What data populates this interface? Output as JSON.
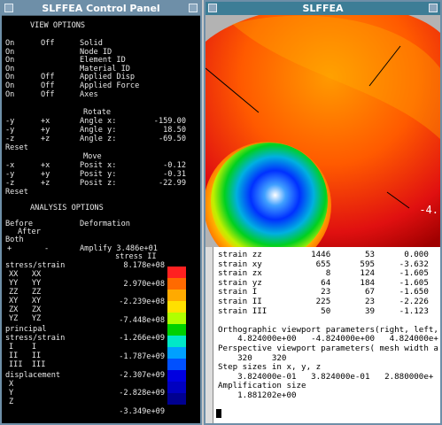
{
  "control_panel": {
    "title": "SLFFEA Control Panel",
    "view_header": "VIEW OPTIONS",
    "view_rows": [
      {
        "a": "On",
        "b": "Off",
        "label": "Solid"
      },
      {
        "a": "On",
        "b": "",
        "label": "Node ID"
      },
      {
        "a": "On",
        "b": "",
        "label": "Element ID"
      },
      {
        "a": "On",
        "b": "",
        "label": "Material ID"
      },
      {
        "a": "On",
        "b": "Off",
        "label": "Applied Disp"
      },
      {
        "a": "On",
        "b": "Off",
        "label": "Applied Force"
      },
      {
        "a": "On",
        "b": "Off",
        "label": "Axes"
      }
    ],
    "rotate_header": "Rotate",
    "rotate_rows": [
      {
        "a": "-y",
        "b": "+x",
        "label": "Angle x:",
        "value": "-159.00"
      },
      {
        "a": "-y",
        "b": "+y",
        "label": "Angle y:",
        "value": "18.50"
      },
      {
        "a": "-z",
        "b": "+z",
        "label": "Angle z:",
        "value": "-69.50"
      }
    ],
    "rotate_reset": "Reset",
    "move_header": "Move",
    "move_rows": [
      {
        "a": "-x",
        "b": "+x",
        "label": "Posit x:",
        "value": "-0.12"
      },
      {
        "a": "-y",
        "b": "+y",
        "label": "Posit y:",
        "value": "-0.31"
      },
      {
        "a": "-z",
        "b": "+z",
        "label": "Posit z:",
        "value": "-22.99"
      }
    ],
    "move_reset": "Reset",
    "analysis_header": "ANALYSIS OPTIONS",
    "before": "Before",
    "deformation": "Deformation",
    "after": "After",
    "both": "Both",
    "plus": "+",
    "minus": "-",
    "amplify": "Amplify 3.486e+01",
    "stress_label": "stress II",
    "stress_strain": "stress/strain",
    "legend_values": [
      "8.178e+08",
      "2.970e+08",
      "-2.239e+08",
      "-7.448e+08",
      "-1.266e+09",
      "-1.787e+09",
      "-2.307e+09",
      "-2.828e+09",
      "-3.349e+09"
    ],
    "left_list": [
      "XX   XX",
      "YY   YY",
      "ZZ   ZZ",
      "XY   XY",
      "ZX   ZX",
      "YZ   YZ"
    ],
    "principal": "principal",
    "stress_strain2": "stress/strain",
    "principal_rows": [
      "I    I",
      "II   II",
      "III  III"
    ],
    "displacement": "displacement",
    "disp_rows": [
      "X",
      "Y",
      "Z"
    ],
    "legend_colors": [
      "#ff2020",
      "#ff6a00",
      "#ffaa00",
      "#ffe000",
      "#b0ff00",
      "#00d000",
      "#00e8c8",
      "#00a0ff",
      "#0050ff",
      "#0000e0",
      "#0000c0",
      "#000090"
    ]
  },
  "viewer": {
    "title": "SLFFEA",
    "axis_label": "-4.",
    "console_lines": [
      "strain zz          1446       53      0.000",
      "strain xy           655      595     -3.632",
      "strain zx             8      124     -1.605",
      "strain yz            64      184     -1.605",
      "strain I             23       67     -1.650",
      "strain II           225       23     -2.226",
      "strain III           50       39     -1.123",
      "",
      "Orthographic viewport parameters(right, left,",
      "    4.824000e+00   -4.824000e+00   4.824000e+",
      "Perspective viewport parameters( mesh width a",
      "    320    320",
      "Step sizes in x, y, z",
      "    3.824000e-01   3.824000e-01   2.880000e+",
      "Amplification size",
      "    1.881202e+00"
    ]
  }
}
